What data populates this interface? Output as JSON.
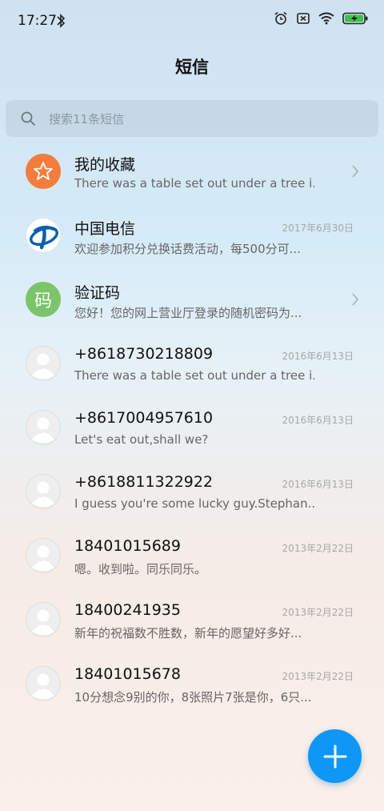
{
  "status_bar": {
    "time": "17:27",
    "icons": [
      "bluetooth-icon",
      "alarm-icon",
      "sim-off-icon",
      "wifi-icon",
      "battery-charging-icon"
    ]
  },
  "header": {
    "title": "短信"
  },
  "search": {
    "placeholder": "搜索11条短信"
  },
  "conversations": [
    {
      "name": "我的收藏",
      "snippet": "There was a table set out under a tree i...",
      "date": "",
      "avatar": "star-icon",
      "avatar_color": "#f47c3c",
      "has_chevron": true
    },
    {
      "name": "中国电信",
      "snippet": "欢迎参加积分兑换话费活动，每500分可...",
      "date": "2017年6月30日",
      "avatar": "china-telecom-logo",
      "avatar_color": "#0a5fb0",
      "has_chevron": false
    },
    {
      "name": "验证码",
      "snippet": "您好！您的网上营业厅登录的随机密码为...",
      "date": "",
      "avatar": "码",
      "avatar_color": "#7bc46a",
      "has_chevron": true
    },
    {
      "name": "+8618730218809",
      "snippet": "There was a table set out under a tree i...",
      "date": "2016年6月13日",
      "avatar": "person-icon",
      "has_chevron": false
    },
    {
      "name": "+8617004957610",
      "snippet": "Let's eat out,shall we?",
      "date": "2016年6月13日",
      "avatar": "person-icon",
      "has_chevron": false
    },
    {
      "name": "+8618811322922",
      "snippet": "I guess you're some lucky guy.Stephan...",
      "date": "2016年6月13日",
      "avatar": "person-icon",
      "has_chevron": false
    },
    {
      "name": "18401015689",
      "snippet": "嗯。收到啦。同乐同乐。",
      "date": "2013年2月22日",
      "avatar": "person-icon",
      "has_chevron": false
    },
    {
      "name": "18400241935",
      "snippet": "新年的祝福数不胜数，新年的愿望好多好...",
      "date": "2013年2月22日",
      "avatar": "person-icon",
      "has_chevron": false
    },
    {
      "name": "18401015678",
      "snippet": "10分想念9别的你，8张照片7张是你，6只...",
      "date": "2013年2月22日",
      "avatar": "person-icon",
      "has_chevron": false
    }
  ],
  "fab": {
    "icon": "plus-icon",
    "color": "#0e97f5"
  }
}
